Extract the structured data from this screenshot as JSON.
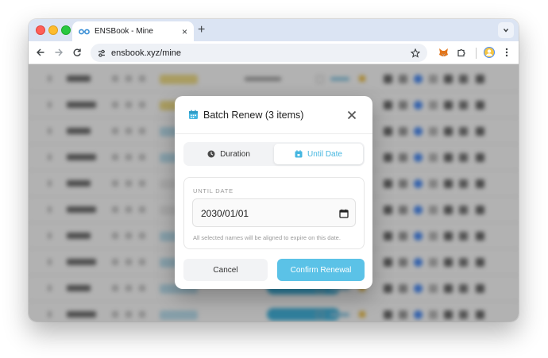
{
  "colors": {
    "accent": "#45b6e0",
    "confirm_button": "#5bc2e7",
    "tab_bar": "#dbe4f3",
    "overlay": "rgba(0,0,0,0.30)"
  },
  "browser": {
    "tab": {
      "title": "ENSBook - Mine",
      "favicon": "ens-glasses-icon",
      "close_label": "×"
    },
    "new_tab_label": "+",
    "url": "ensbook.xyz/mine",
    "icons": [
      "back-arrow-icon",
      "forward-arrow-icon",
      "reload-icon",
      "site-info-icon",
      "bookmark-star-icon",
      "metamask-fox-icon",
      "extensions-puzzle-icon",
      "profile-avatar-icon",
      "kebab-menu-icon",
      "tab-search-chevron-icon"
    ]
  },
  "modal": {
    "title": "Batch Renew (3 items)",
    "title_icon": "calendar-icon",
    "close_icon": "close-x-icon",
    "tabs": [
      {
        "label": "Duration",
        "icon": "clock-icon",
        "active": false
      },
      {
        "label": "Until Date",
        "icon": "calendar-icon",
        "active": true
      }
    ],
    "until_date": {
      "label": "UNTIL DATE",
      "value": "2030/01/01",
      "picker_icon": "calendar-picker-icon",
      "help": "All selected names will be aligned to expire on this date."
    },
    "cancel_label": "Cancel",
    "confirm_label": "Confirm Renewal"
  }
}
